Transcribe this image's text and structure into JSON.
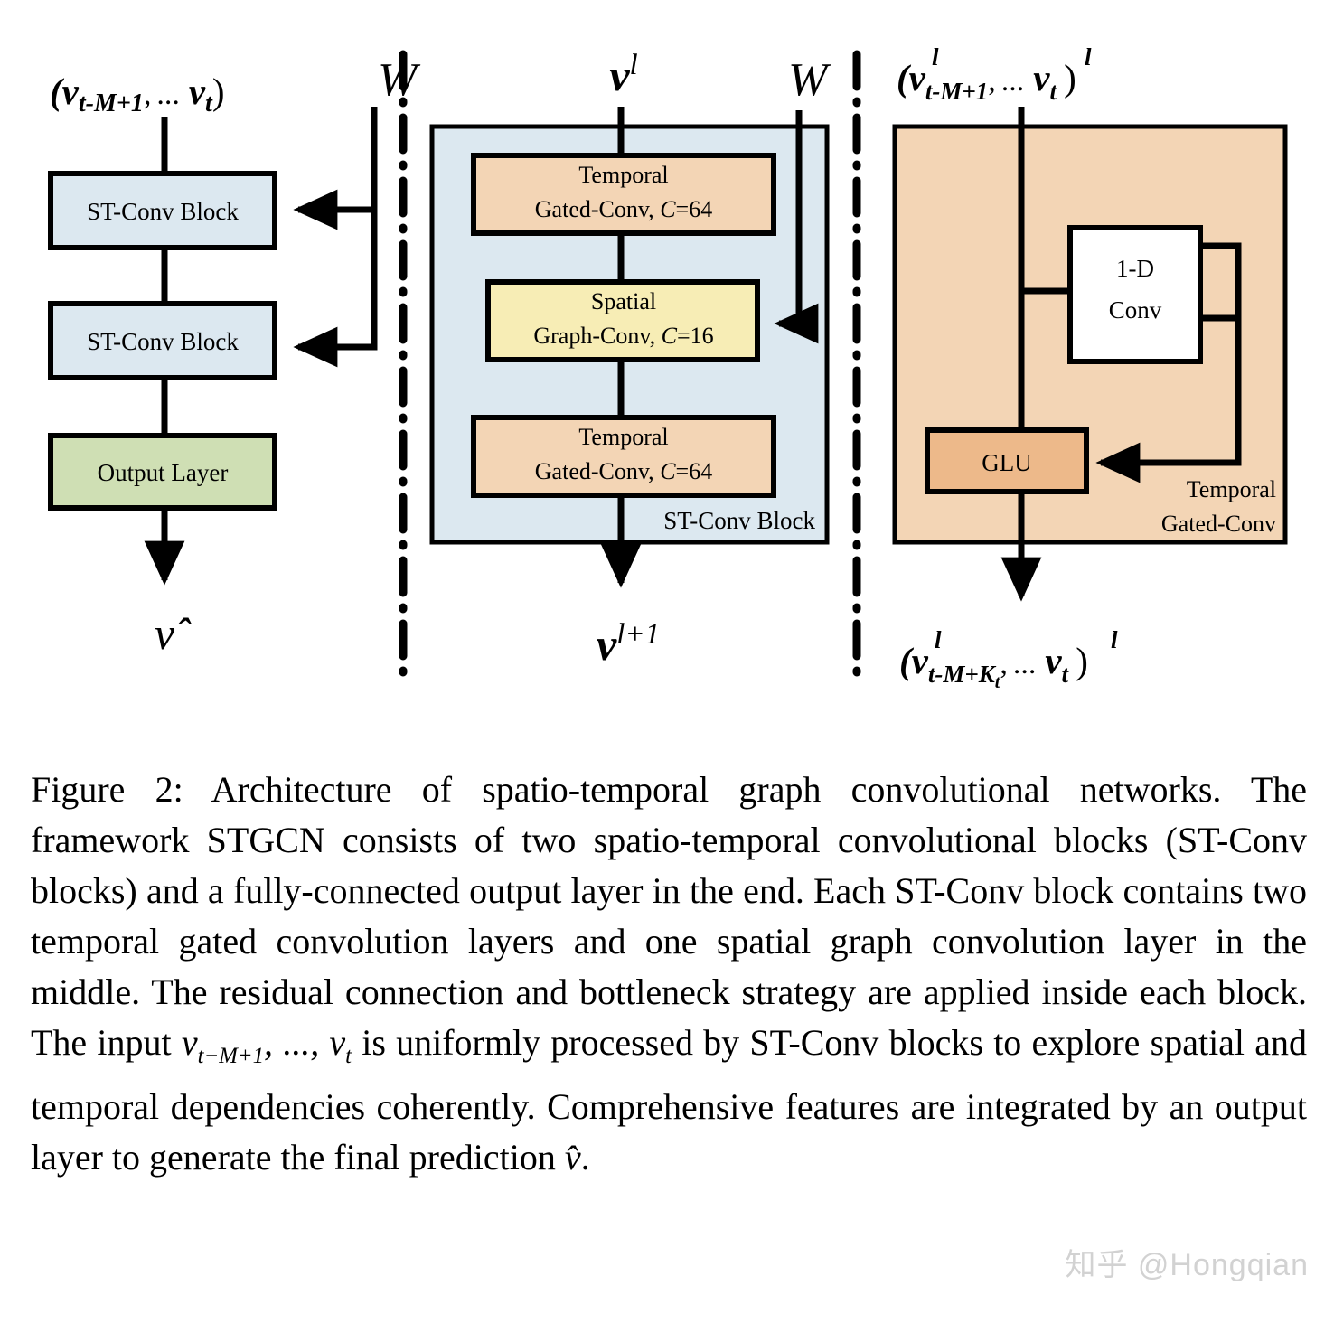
{
  "figure": {
    "label": "Figure 2",
    "panels": [
      {
        "name": "overall-architecture",
        "input_label": "( νt-M+1, ... νt )",
        "output_label": "ν̂",
        "weight_label": "W",
        "blocks": [
          {
            "label": "ST-Conv Block",
            "color": "#dce8f0"
          },
          {
            "label": "ST-Conv Block",
            "color": "#dce8f0"
          },
          {
            "label": "Output Layer",
            "color": "#cfdfb4"
          }
        ]
      },
      {
        "name": "st-conv-block-detail",
        "input_label": "ν l",
        "output_label": "ν l+1",
        "weight_label": "W",
        "container_label": "ST-Conv Block",
        "container_color": "#dce8f0",
        "blocks": [
          {
            "label_line1": "Temporal",
            "label_line2": "Gated-Conv, C=64",
            "color": "#f3d5b5"
          },
          {
            "label_line1": "Spatial",
            "label_line2": "Graph-Conv, C=16",
            "color": "#f7edb5"
          },
          {
            "label_line1": "Temporal",
            "label_line2": "Gated-Conv, C=64",
            "color": "#f3d5b5"
          }
        ]
      },
      {
        "name": "temporal-gated-conv-detail",
        "input_label": "( ν l t-M+1, ... ν l t )",
        "output_label": "( ν l t-M+Kt, ... ν l t )",
        "container_label_line1": "Temporal",
        "container_label_line2": "Gated-Conv",
        "container_color": "#f3d5b5",
        "blocks": [
          {
            "label_line1": "1-D",
            "label_line2": "Conv",
            "color": "#ffffff"
          },
          {
            "label": "GLU",
            "color": "#edb98a"
          }
        ]
      }
    ],
    "colors": {
      "light_blue": "#dce8f0",
      "peach": "#f3d5b5",
      "yellow": "#f7edb5",
      "green": "#cfdfb4",
      "dark_orange": "#edb98a",
      "stroke": "#000000",
      "white": "#ffffff"
    }
  },
  "caption": {
    "prefix": "Figure 2:",
    "part1": " Architecture of spatio-temporal graph convolutional networks. The framework STGCN consists of two spatio-temporal convolutional blocks (ST-Conv blocks) and a fully-connected output layer in the end. Each ST-Conv block contains two temporal gated convolution layers and one spatial graph convolution layer in the middle. The residual connection and bottleneck strategy are applied inside each block. The input ",
    "math_input": "vt−M+1, ..., vt",
    "part2": " is uniformly processed by ST-Conv blocks to explore spatial and temporal dependencies coherently. Comprehensive features are integrated by an output layer to generate the final prediction ",
    "math_output": "v̂",
    "part3": "."
  },
  "watermark": {
    "text": "知乎 @Hongqian",
    "color": "#d2d2d2"
  }
}
